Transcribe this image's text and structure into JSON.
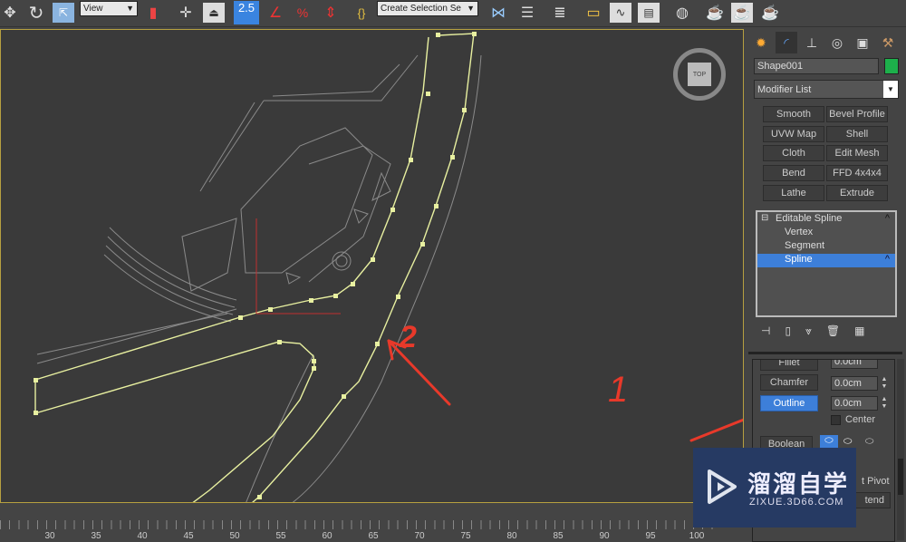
{
  "toolbar": {
    "reference_coord": "View",
    "snap_value": "2.5",
    "selection_set_placeholder": "Create Selection Se",
    "icons": [
      "move-icon",
      "rotate-icon",
      "scale-icon",
      "mirror-pivot-icon",
      "select-manipulate-icon",
      "keyboard-shortcut-icon",
      "snap-toggle-icon",
      "angle-snap-icon",
      "percent-snap-icon",
      "spinner-snap-icon",
      "edit-named-selection-icon",
      "mirror-icon",
      "align-icon",
      "layer-manager-icon",
      "scene-explorer-icon",
      "curve-editor-icon",
      "schematic-view-icon",
      "material-editor-icon",
      "render-setup-icon",
      "rendered-frame-icon",
      "render-icon"
    ]
  },
  "viewport": {
    "viewcube_label": "TOP",
    "annotations": [
      "2",
      "1"
    ],
    "annotation_color": "#e8392a",
    "spline_color": "#e8f0a0"
  },
  "ruler": {
    "labels": [
      "30",
      "35",
      "40",
      "45",
      "50",
      "55",
      "60",
      "65",
      "70",
      "75",
      "80",
      "85",
      "90",
      "95",
      "100"
    ]
  },
  "panel": {
    "tabs": [
      "create-icon",
      "modify-icon",
      "hierarchy-icon",
      "motion-icon",
      "display-icon",
      "utilities-icon"
    ],
    "object_name": "Shape001",
    "object_color": "#1db04b",
    "modifier_list": "Modifier List",
    "modifier_buttons": [
      "Smooth",
      "Bevel Profile",
      "UVW Map",
      "Shell",
      "Cloth",
      "Edit Mesh",
      "Bend",
      "FFD 4x4x4",
      "Lathe",
      "Extrude"
    ],
    "stack": {
      "root": "Editable Spline",
      "items": [
        "Vertex",
        "Segment",
        "Spline"
      ],
      "selected": "Spline"
    },
    "geometry": {
      "fillet_label": "Fillet",
      "fillet_value": "0.0cm",
      "chamfer_label": "Chamfer",
      "chamfer_value": "0.0cm",
      "outline_label": "Outline",
      "outline_value": "0.0cm",
      "center_label": "Center",
      "center_checked": false,
      "boolean_label": "Boolean",
      "pivot_label_partial": "t Pivot",
      "extend_label_partial": "tend"
    },
    "accent": "#3d7fd9"
  },
  "watermark": {
    "title": "溜溜自学",
    "url": "ZIXUE.3D66.COM"
  }
}
